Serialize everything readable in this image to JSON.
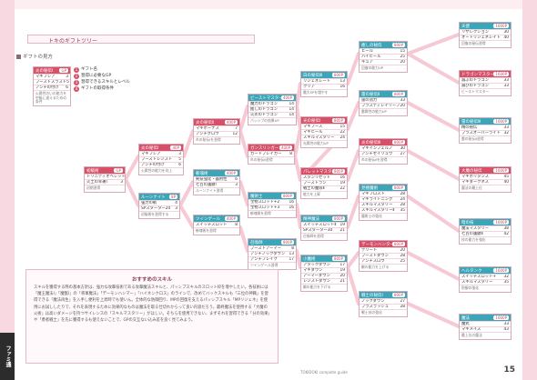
{
  "header": {
    "title": "トキのギフトツリー"
  },
  "section": {
    "label": "ギフトの見方"
  },
  "legend": {
    "items": [
      {
        "num": "1",
        "text": "ギフト名"
      },
      {
        "num": "2",
        "text": "習得に必要なGP"
      },
      {
        "num": "3",
        "text": "習得できるスキルとレベル"
      },
      {
        "num": "4",
        "text": "ギフトの取得条件"
      }
    ]
  },
  "sample": {
    "header": "炎の秘伝Ⅰ",
    "sp": "GP",
    "rows": [
      {
        "name": "マギフレア",
        "lv": "3"
      },
      {
        "name": "ブーストスラスト",
        "lv": "5"
      },
      {
        "name": "アンチの付け",
        "lv": "6"
      }
    ],
    "note": "火属性のいの能力を中級に違えるための条件"
  },
  "rec": {
    "title": "おすすめのスキル",
    "body": "スキルを獲得する際の基本方針は、強力な攻撃技術である攻撃魔法スキルと、パッシブスキルのスロット枠を増やしたい。各技術には「魔王魔法Ⅰ」「魔獣Ⅰ」の「将軍魔法」「デーモンハンマー」「ハイネンクロス」のラインで、改めてバックスキルも「三位の神職」を習得できる「魔法再生」を入手し便利を上昇時でも使いん。全体的な防御回り、MPの回復を支えるパッシブスキル「MPリジェネ」を使用にお試ししたりで、それを表現するために効果的なものは魔法を取る仕切れからって良い内容だろう。最終魔法を使用する「大魔の火術」は高いダメージを持つサイレンスの「スキルマスタリー」がほしい。そちらを使用できない、まずそれを習得できる「分の効果」や「勇者戦士」を先に獲得するも使えないことで、GPの交互ない込み差を良く見てみよう。"
  },
  "footer": {
    "left": "TOKIDOKI complete guide",
    "page": "15",
    "logo": "ファミ通"
  },
  "boxes": [
    {
      "id": "root",
      "title": "初級術",
      "sp": "GP",
      "c": "red",
      "rows": [
        [
          "トリニティオベレット",
          "3"
        ],
        [
          "火土の幸運Ⅰ",
          "3"
        ]
      ],
      "note": "初期習得"
    },
    {
      "id": "f1",
      "title": "炎の秘伝Ⅰ",
      "sp": "40P",
      "c": "red",
      "rows": [
        [
          "マギフレア",
          "3"
        ],
        [
          "ブーストレジスト",
          "5"
        ],
        [
          "アンチの付け",
          "6"
        ]
      ],
      "note": "火属性の能力を向上"
    },
    {
      "id": "l1",
      "title": "ルーンナイト",
      "sp": "8P",
      "c": "teal",
      "rows": [
        [
          "強力の斬",
          "4"
        ],
        [
          "SPスターター20",
          "3"
        ]
      ],
      "note": "初級術を習得する"
    },
    {
      "id": "f2",
      "title": "炎の秘伝Ⅱ",
      "sp": "400P",
      "c": "red",
      "rows": [
        [
          "マギボーナス",
          "7"
        ],
        [
          "アンチグロウ",
          "12"
        ]
      ],
      "note": "炎の秘伝Ⅰを習得"
    },
    {
      "id": "k1",
      "title": "斬魂術",
      "sp": "400P",
      "c": "teal",
      "rows": [
        [
          "剣技強化・器用性",
          "6"
        ],
        [
          "七百の護鍵Ⅰ",
          "3"
        ]
      ],
      "note": "ルーンナイト習得"
    },
    {
      "id": "t1",
      "title": "ツインゲール",
      "sp": "400P",
      "c": "teal",
      "rows": [
        [
          "スイッチスロット",
          "8"
        ]
      ],
      "note": "斬魂術を習得"
    },
    {
      "id": "b1",
      "title": "ビーストマスター",
      "sp": "400P",
      "c": "teal",
      "rows": [
        [
          "魔力のドラゴン",
          "14"
        ],
        [
          "癒しのドラゴン",
          "14"
        ],
        [
          "火炎のドラゴン",
          "14"
        ]
      ],
      "note": "パッシブの効果UP"
    },
    {
      "id": "g1",
      "title": "ガンスリンガー",
      "sp": "400P",
      "c": "red",
      "rows": [
        [
          "ガードブレイカー",
          "8"
        ]
      ],
      "note": "炎の秘伝Ⅱ習得"
    },
    {
      "id": "d1",
      "title": "魔術士",
      "sp": "800P",
      "c": "teal",
      "rows": [
        [
          "宝物スロット+2",
          "16"
        ],
        [
          "宝物スロット+3",
          "16"
        ]
      ],
      "note": "斬魂術を習得"
    },
    {
      "id": "s1",
      "title": "召喚師",
      "sp": "800P",
      "c": "teal",
      "rows": [
        [
          "ブーストアーマー",
          "8"
        ],
        [
          "アンチノックダウン",
          "13"
        ],
        [
          "アンチブレイク",
          "17"
        ]
      ],
      "note": "ツインゲール習得"
    },
    {
      "id": "m1",
      "title": "白の秘伝Ⅲ",
      "sp": "800P",
      "c": "teal",
      "rows": [
        [
          "リジェネレート",
          "13"
        ],
        [
          "クリア",
          "16"
        ]
      ],
      "note": "最大SPを増やす"
    },
    {
      "id": "m2",
      "title": "光の秘伝Ⅰ",
      "sp": "800P",
      "c": "red",
      "rows": [
        [
          "マギフース",
          "15"
        ],
        [
          "マギヒール",
          "22"
        ],
        [
          "スキルマスタリー",
          "24"
        ]
      ],
      "note": "光属性の能力UP"
    },
    {
      "id": "p1",
      "title": "パレットマスター",
      "sp": "800P",
      "c": "red",
      "rows": [
        [
          "スタンリセット",
          "16"
        ],
        [
          "ブーストラン",
          "19"
        ],
        [
          "戦士の魔導Ⅱ",
          "22"
        ]
      ],
      "note": "能力を上昇"
    },
    {
      "id": "h1",
      "title": "精神魔法",
      "sp": "800P",
      "c": "teal",
      "rows": [
        [
          "スイッチスロットⅡ",
          "19"
        ],
        [
          "SPスターター30",
          "21"
        ]
      ],
      "note": "召喚師を習得"
    },
    {
      "id": "z1",
      "title": "小魔術",
      "sp": "800P",
      "c": "teal",
      "rows": [
        [
          "アタックダウン",
          "17"
        ],
        [
          "マギダウン",
          "19"
        ],
        [
          "アーマーダウン",
          "20"
        ],
        [
          "レジストダウン",
          "21"
        ]
      ],
      "note": "敵の能力を下げる"
    },
    {
      "id": "r1",
      "title": "癒しの秘伝",
      "sp": "800P",
      "c": "teal",
      "rows": [
        [
          "ヒール",
          "15"
        ],
        [
          "ハイヒール",
          "25"
        ],
        [
          "キュア",
          "20"
        ]
      ],
      "note": "回復の能力UP"
    },
    {
      "id": "r2",
      "title": "雷の秘伝Ⅱ",
      "sp": "800P",
      "c": "teal",
      "rows": [
        [
          "雷の効力",
          "33"
        ],
        [
          "プラスディレイリーフ",
          "20"
        ]
      ],
      "note": "雷属性の能力UP"
    },
    {
      "id": "r3",
      "title": "炎の秘伝Ⅲ",
      "sp": "800P",
      "c": "red",
      "rows": [
        [
          "マギインフェルノ",
          "30"
        ],
        [
          "アンチセイリュウ",
          "27"
        ]
      ],
      "note": "炎の秘伝Ⅱを習得"
    },
    {
      "id": "r4",
      "title": "見極魔術",
      "sp": "800P",
      "c": "teal",
      "rows": [
        [
          "マギフロスト",
          "28"
        ],
        [
          "マギライトニング",
          "24"
        ],
        [
          "スキルマスタリー",
          "28"
        ],
        [
          "スキルマスタリーⅡ",
          "35"
        ]
      ],
      "note": "魔術士の強化"
    },
    {
      "id": "r5",
      "title": "デーモンハンター",
      "sp": "800P",
      "c": "red",
      "rows": [
        [
          "デリート",
          "20"
        ],
        [
          "ブーストダウン",
          "28"
        ],
        [
          "アンチスロウ",
          "25"
        ]
      ],
      "note": "敵の能力を上げる"
    },
    {
      "id": "r6",
      "title": "戦士の秘伝Ⅰ",
      "sp": "800P",
      "c": "teal",
      "rows": [
        [
          "ノックダウン",
          "27"
        ],
        [
          "プラスラッシュ",
          "28"
        ]
      ],
      "note": "戦士技の強化"
    },
    {
      "id": "q1",
      "title": "天使",
      "sp": "1600P",
      "c": "teal",
      "rows": [
        [
          "リザレクション",
          "30"
        ],
        [
          "オートリジェネレイト",
          "40"
        ]
      ],
      "note": "回復の秘伝習得"
    },
    {
      "id": "q2",
      "title": "ドラゴンマスター",
      "sp": "1600P",
      "c": "red",
      "rows": [
        [
          "滅ぶのドラゴン",
          "33"
        ],
        [
          "滅びのドラゴン",
          "33"
        ]
      ],
      "note": "ビーストマスター"
    },
    {
      "id": "q3",
      "title": "雷の秘伝Ⅲ",
      "sp": "1600P",
      "c": "teal",
      "rows": [
        [
          "精の秘伝",
          "33"
        ],
        [
          "プラスオーバーライト",
          "32"
        ]
      ],
      "note": "雷の秘伝Ⅱ習得"
    },
    {
      "id": "q4",
      "title": "大魔の秘伝",
      "sp": "1600P",
      "c": "red",
      "rows": [
        [
          "マギホリタンス",
          "45"
        ],
        [
          "マギダークネス",
          "40"
        ]
      ],
      "note": "魔法の最上位"
    },
    {
      "id": "q5",
      "title": "暗の技",
      "sp": "1600P",
      "c": "teal",
      "rows": [
        [
          "魔法マスタリー",
          "38"
        ],
        [
          "七百の護鍵Ⅱ",
          "42"
        ]
      ],
      "note": "技の能力を強化"
    },
    {
      "id": "q6",
      "title": "ヘルタンク",
      "sp": "1600P",
      "c": "teal",
      "rows": [
        [
          "スイッチスロット+",
          "32"
        ],
        [
          "スキルマスタリー",
          "35"
        ]
      ],
      "note": "防御の強化"
    },
    {
      "id": "q7",
      "title": "魔法",
      "sp": "1600P",
      "c": "teal",
      "rows": [
        [
          "魔式",
          "33"
        ],
        [
          "マギメイス",
          "43"
        ]
      ],
      "note": "最上位の魔法"
    }
  ]
}
